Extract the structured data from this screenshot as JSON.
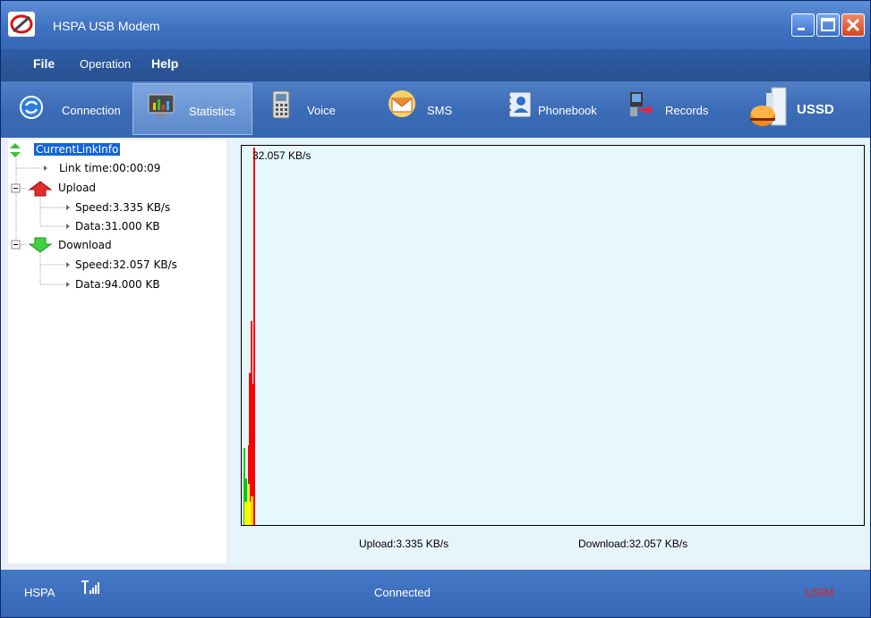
{
  "window": {
    "title": "HSPA USB Modem",
    "app_icon": "modem-logo-icon",
    "controls": [
      "minimize-icon",
      "maximize-icon",
      "close-icon"
    ]
  },
  "menu": {
    "items": [
      {
        "label": "File"
      },
      {
        "label": "Operation"
      },
      {
        "label": "Help"
      }
    ]
  },
  "toolbar": {
    "items": [
      {
        "label": "Connection",
        "icon": "connection-icon"
      },
      {
        "label": "Statistics",
        "icon": "statistics-icon",
        "active": true
      },
      {
        "label": "Voice",
        "icon": "phone-icon"
      },
      {
        "label": "SMS",
        "icon": "envelope-icon"
      },
      {
        "label": "Phonebook",
        "icon": "phonebook-icon"
      },
      {
        "label": "Records",
        "icon": "records-icon"
      },
      {
        "label": "USSD",
        "icon": "ussd-icon"
      }
    ]
  },
  "tree": {
    "root": "CurrentLinkInfo",
    "link_time": "Link time:00:00:09",
    "upload": {
      "label": "Upload",
      "speed": "Speed:3.335 KB/s",
      "data": "Data:31.000 KB"
    },
    "download": {
      "label": "Download",
      "speed": "Speed:32.057 KB/s",
      "data": "Data:94.000 KB"
    }
  },
  "graph": {
    "peak_label": "32.057 KB/s",
    "upload_footer": "Upload:3.335 KB/s",
    "download_footer": "Download:32.057 KB/s",
    "colors": {
      "download": "#ff0000",
      "upload": "#00cc00",
      "overlap": "#ffff00",
      "background": "#e6f7fd"
    }
  },
  "status": {
    "network": "HSPA",
    "signal_icon": "signal-strength-icon",
    "connection": "Connected",
    "sim": "USIM"
  }
}
